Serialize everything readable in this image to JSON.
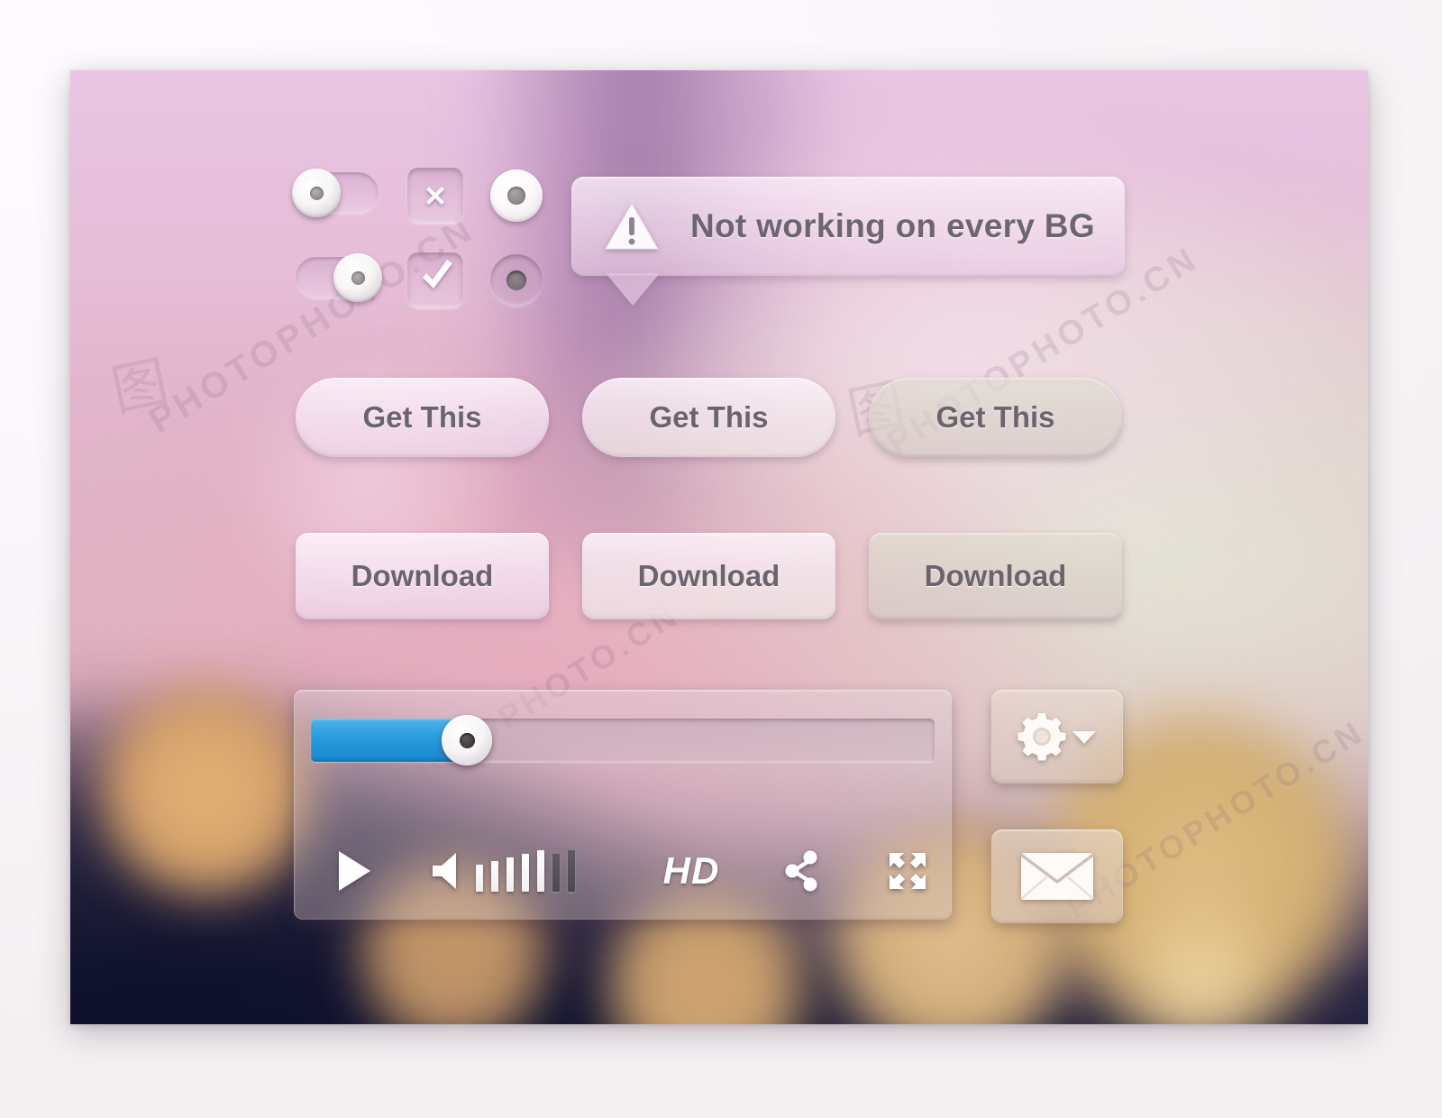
{
  "theme": {
    "frame_bg": "#faf8fa",
    "panel_pink": "#e9cbe5",
    "panel_mauve": "#d8a9b8",
    "panel_dark": "#17182f",
    "accent_blue": "#2a9ede",
    "text_gray": "#6b646d",
    "icon_white": "#ffffff",
    "bokeh_gold": "#d6a16a"
  },
  "watermark": {
    "text": "PHOTOPHOTO.CN",
    "logo_glyph": "图"
  },
  "controls": {
    "toggles": [
      {
        "name": "toggle-off",
        "state": "off",
        "knob_side": "left"
      },
      {
        "name": "toggle-on",
        "state": "on",
        "knob_side": "right"
      }
    ],
    "checkboxes": [
      {
        "name": "checkbox-x",
        "glyph": "✕",
        "checked": false
      },
      {
        "name": "checkbox-check",
        "glyph": "✓",
        "checked": true
      }
    ],
    "radios": [
      {
        "name": "radio-raised",
        "style": "raised",
        "selected": true
      },
      {
        "name": "radio-inset",
        "style": "inset",
        "selected": false
      }
    ]
  },
  "tooltip": {
    "icon": "warning-triangle-icon",
    "icon_glyph": "!",
    "message": "Not working on every BG"
  },
  "buttons": {
    "pill_row": [
      {
        "label": "Get This",
        "variant": "light"
      },
      {
        "label": "Get This",
        "variant": "cream"
      },
      {
        "label": "Get This",
        "variant": "muted"
      }
    ],
    "rect_row": [
      {
        "label": "Download",
        "variant": "light"
      },
      {
        "label": "Download",
        "variant": "cream"
      },
      {
        "label": "Download",
        "variant": "muted"
      }
    ]
  },
  "player": {
    "progress_percent": 25,
    "play_icon": "play-icon",
    "volume": {
      "icon": "speaker-icon",
      "bars_total": 7,
      "bars_active": 5
    },
    "quality_label": "HD",
    "share_icon": "share-icon",
    "fullscreen_icon": "fullscreen-icon"
  },
  "side_buttons": [
    {
      "name": "settings-button",
      "icon": "gear-icon",
      "has_dropdown": true,
      "dropdown_icon": "chevron-down-icon"
    },
    {
      "name": "mail-button",
      "icon": "envelope-icon",
      "has_dropdown": false
    }
  ]
}
